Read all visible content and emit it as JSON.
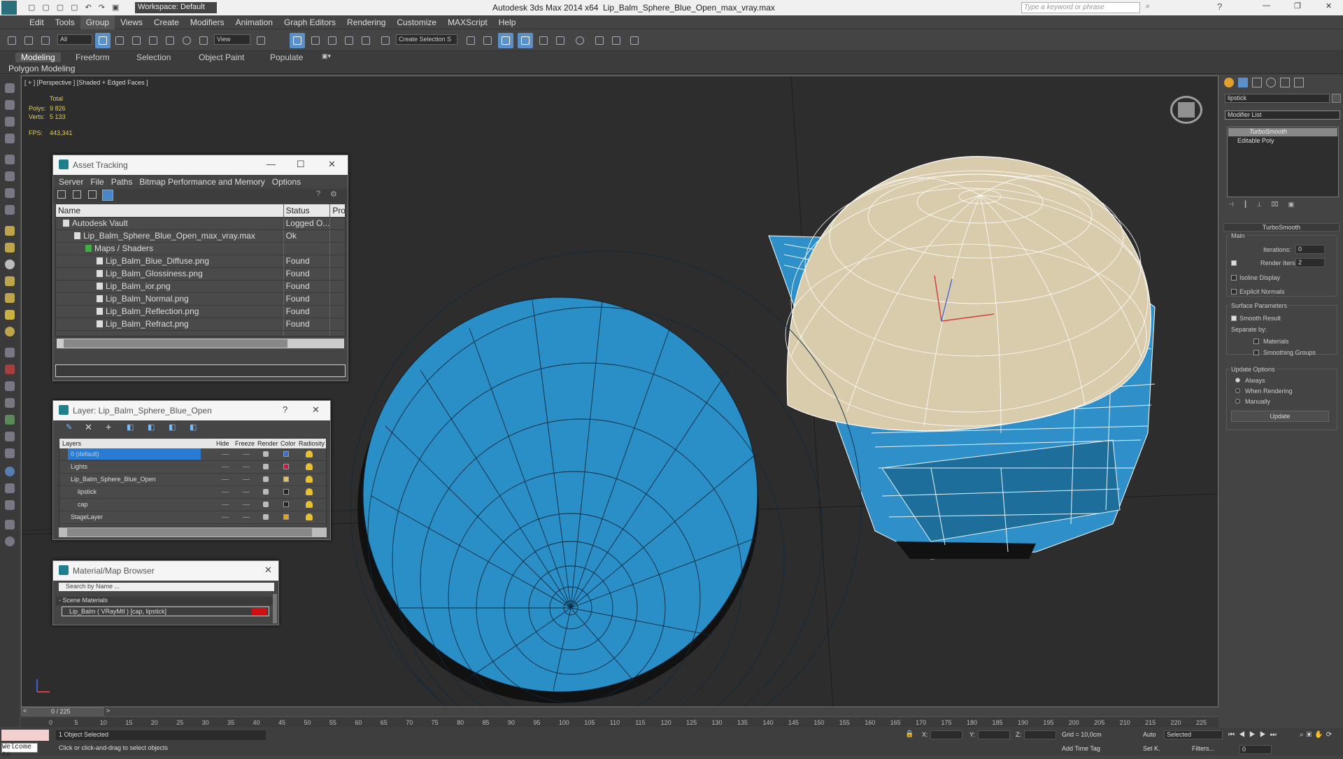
{
  "app": {
    "title": "Autodesk 3ds Max  2014 x64",
    "file": "Lip_Balm_Sphere_Blue_Open_max_vray.max",
    "workspace": "Workspace: Default",
    "search_placeholder": "Type a keyword or phrase"
  },
  "menu": [
    "Edit",
    "Tools",
    "Group",
    "Views",
    "Create",
    "Modifiers",
    "Animation",
    "Graph Editors",
    "Rendering",
    "Customize",
    "MAXScript",
    "Help"
  ],
  "toolbar": {
    "filter": "All",
    "refcoord": "View",
    "selset": "Create Selection S"
  },
  "ribbon": {
    "tabs": [
      "Modeling",
      "Freeform",
      "Selection",
      "Object Paint",
      "Populate"
    ],
    "active": "Modeling",
    "sub": "Polygon Modeling"
  },
  "viewport": {
    "label": "[ + ] [Perspective ] [Shaded + Edged Faces ]",
    "stats": {
      "total": "Total",
      "polys_label": "Polys:",
      "polys": "9 826",
      "verts_label": "Verts:",
      "verts": "5 133",
      "fps_label": "FPS:",
      "fps": "443,341"
    }
  },
  "asset": {
    "title": "Asset Tracking",
    "menu": [
      "Server",
      "File",
      "Paths",
      "Bitmap Performance and Memory",
      "Options"
    ],
    "cols": [
      "Name",
      "Status",
      "Pro"
    ],
    "rows": [
      {
        "name": "Autodesk Vault",
        "status": "Logged O...",
        "indent": 1
      },
      {
        "name": "Lip_Balm_Sphere_Blue_Open_max_vray.max",
        "status": "Ok",
        "indent": 2
      },
      {
        "name": "Maps / Shaders",
        "status": "",
        "indent": 3
      },
      {
        "name": "Lip_Balm_Blue_Diffuse.png",
        "status": "Found",
        "indent": 4
      },
      {
        "name": "Lip_Balm_Glossiness.png",
        "status": "Found",
        "indent": 4
      },
      {
        "name": "Lip_Balm_ior.png",
        "status": "Found",
        "indent": 4
      },
      {
        "name": "Lip_Balm_Normal.png",
        "status": "Found",
        "indent": 4
      },
      {
        "name": "Lip_Balm_Reflection.png",
        "status": "Found",
        "indent": 4
      },
      {
        "name": "Lip_Balm_Refract.png",
        "status": "Found",
        "indent": 4
      }
    ]
  },
  "layer": {
    "title": "Layer: Lip_Balm_Sphere_Blue_Open",
    "cols": [
      "Layers",
      "Hide",
      "Freeze",
      "Render",
      "Color",
      "Radiosity"
    ],
    "rows": [
      {
        "name": "0 (default)",
        "color": "#3a6fd0",
        "sel": true,
        "indent": 0
      },
      {
        "name": "Lights",
        "color": "#c02040",
        "sel": false,
        "indent": 0
      },
      {
        "name": "Lip_Balm_Sphere_Blue_Open",
        "color": "#e0c060",
        "sel": false,
        "indent": 0
      },
      {
        "name": "lipstick",
        "color": "#222222",
        "sel": false,
        "indent": 1
      },
      {
        "name": "cap",
        "color": "#222222",
        "sel": false,
        "indent": 1
      },
      {
        "name": "StageLayer",
        "color": "#e0a020",
        "sel": false,
        "indent": 0
      }
    ]
  },
  "matbrowser": {
    "title": "Material/Map Browser",
    "search": "Search by Name ...",
    "group": "- Scene Materials",
    "item": "Lip_Balm  ( VRayMtl )  [cap, lipstick]"
  },
  "cmd": {
    "name": "lipstick",
    "modlist": "Modifier List",
    "stack": [
      "TurboSmooth",
      "Editable Poly"
    ],
    "rollout": "TurboSmooth",
    "main": "Main",
    "iterations_label": "Iterations:",
    "iterations": "0",
    "render_iters_label": "Render Iters:",
    "render_iters": "2",
    "isoline": "Isoline Display",
    "explicit": "Explicit Normals",
    "surface": "Surface Parameters",
    "smooth": "Smooth Result",
    "sepby": "Separate by:",
    "materials": "Materials",
    "smgroups": "Smoothing Groups",
    "update_opts": "Update Options",
    "always": "Always",
    "when_rendering": "When Rendering",
    "manually": "Manually",
    "update": "Update"
  },
  "timeline": {
    "frame": "0 / 225",
    "ticks": [
      "0",
      "5",
      "10",
      "15",
      "20",
      "25",
      "30",
      "35",
      "40",
      "45",
      "50",
      "55",
      "60",
      "65",
      "70",
      "75",
      "80",
      "85",
      "90",
      "95",
      "100",
      "105",
      "110",
      "115",
      "120",
      "125",
      "130",
      "135",
      "140",
      "145",
      "150",
      "155",
      "160",
      "165",
      "170",
      "175",
      "180",
      "185",
      "190",
      "195",
      "200",
      "205",
      "210",
      "215",
      "220",
      "225"
    ]
  },
  "status": {
    "welcome": "Welcome to",
    "selected": "1 Object Selected",
    "prompt": "Click or click-and-drag to select objects",
    "x": "X:",
    "y": "Y:",
    "z": "Z:",
    "grid": "Grid = 10,0cm",
    "addtime": "Add Time Tag",
    "auto": "Auto",
    "setk": "Set K.",
    "selmode": "Selected",
    "filters": "Filters...",
    "frame": "0"
  }
}
